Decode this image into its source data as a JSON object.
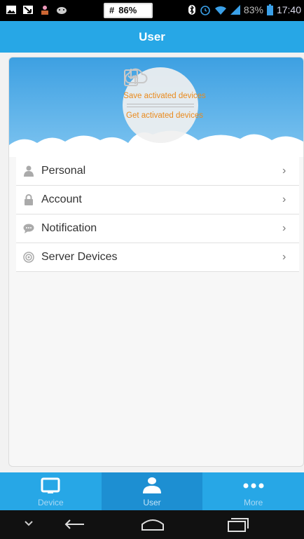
{
  "status_bar": {
    "left_icons": [
      "image-icon",
      "arrow-icon",
      "person-icon",
      "android-icon"
    ],
    "badge_text": "86%",
    "right_battery_pct": "83%",
    "time": "17:40"
  },
  "header": {
    "title": "User"
  },
  "banner": {
    "save_label": "Save activated devices",
    "get_label": "Get activated devices"
  },
  "menu": {
    "items": [
      {
        "label": "Personal",
        "icon": "person-icon"
      },
      {
        "label": "Account",
        "icon": "lock-icon"
      },
      {
        "label": "Notification",
        "icon": "chat-bubble-icon"
      },
      {
        "label": "Server Devices",
        "icon": "signal-icon"
      }
    ]
  },
  "tabs": [
    {
      "label": "Device",
      "icon": "device-icon",
      "active": false
    },
    {
      "label": "User",
      "icon": "user-icon",
      "active": true
    },
    {
      "label": "More",
      "icon": "more-icon",
      "active": false
    }
  ],
  "colors": {
    "primary": "#27a7e6",
    "accent": "#e98a1c",
    "active_tab": "#1d8fd2"
  }
}
